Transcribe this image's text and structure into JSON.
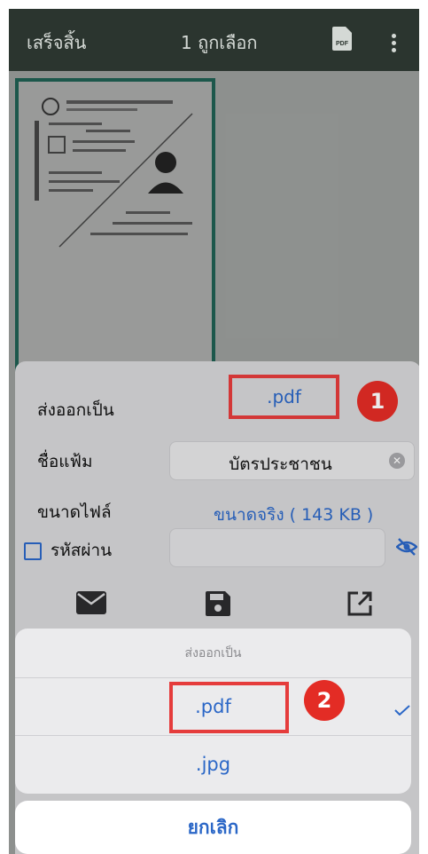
{
  "topbar": {
    "done_label": "เสร็จสิ้น",
    "selected_label": "1 ถูกเลือก",
    "pdf_icon_text": "PDF",
    "pdf_icon": "pdf-file-icon",
    "more_icon": "more-vertical-icon"
  },
  "export_sheet": {
    "export_as_label": "ส่งออกเป็น",
    "export_as_value": ".pdf",
    "filename_label": "ชื่อแฟ้ม",
    "filename_value": "บัตรประชาชน",
    "filesize_label": "ขนาดไฟล์",
    "filesize_value": "ขนาดจริง ( 143 KB )",
    "password_label": "รหัสผ่าน",
    "password_value": "",
    "icons": [
      "mail-icon",
      "save-disk-icon",
      "open-external-icon"
    ]
  },
  "annotations": {
    "badge1": "1",
    "badge2": "2"
  },
  "action_sheet": {
    "title": "ส่งออกเป็น",
    "options": [
      {
        "label": ".pdf",
        "selected": true
      },
      {
        "label": ".jpg",
        "selected": false
      }
    ],
    "cancel_label": "ยกเลิก"
  },
  "colors": {
    "accent": "#2b67c7",
    "annotation_red": "#e32c25",
    "topbar_bg": "#2f3a33"
  }
}
